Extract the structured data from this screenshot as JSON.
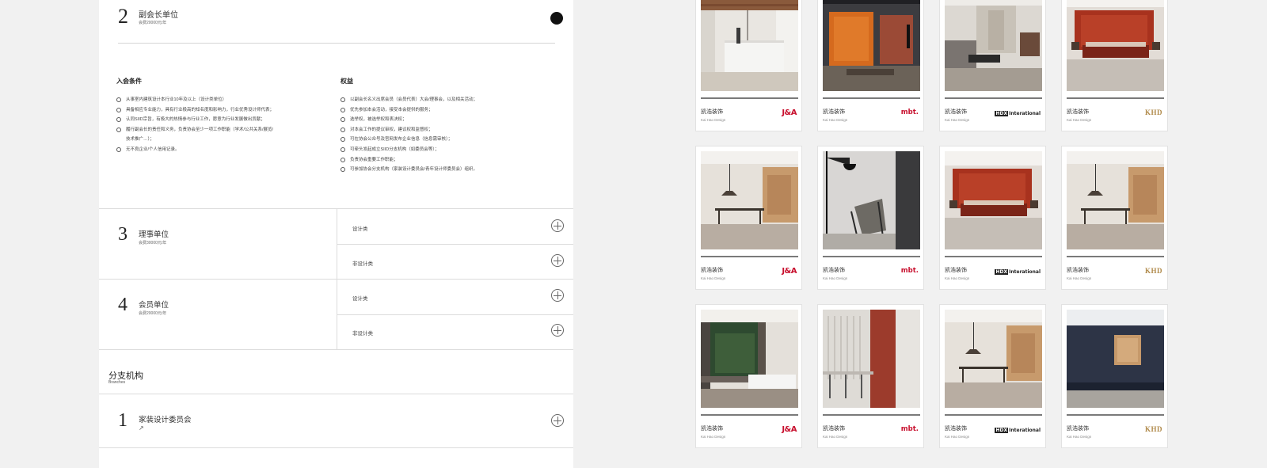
{
  "membership_2": {
    "number": "2",
    "title": "副会长单位",
    "fee": "会费20000元/年",
    "requirements_heading": "入会条件",
    "requirements": [
      "从事室内建筑设计本行业10年及以上（设计类单位）",
      "具备相应专业能力，具有行业极高的知名度和影响力，行业优秀设计师代表；",
      "认同SIID宗旨，有极大的热情参与行业工作，愿意为行业发展做出贡献；",
      "履行副会长的责任和义务，负责协会至少一项工作职能（学术/公共关系/展览/",
      "技术推广…）；",
      "无不良企业/个人信用记录。"
    ],
    "benefits_heading": "权益",
    "benefits": [
      "以副会长名义出席会员（会员代表）大会/理事会，以及相关活动；",
      "优先参加本会活动，接受本会提供的服务；",
      "选举权，被选举权和表决权；",
      "对本会工作的提议审权，建议权和监督权；",
      "可在协会公众号及官网发布企业信息（信息需审核）；",
      "可牵头发起成立SIID分支机构（如委员会等）；",
      "负责协会重要工作职能；",
      "可参加协会分支机构（家装设计委员会/青年设计师委员会）组织。"
    ]
  },
  "membership_3": {
    "number": "3",
    "title": "理事单位",
    "fee": "会费30000元/年",
    "options": [
      "设计类",
      "非设计类"
    ]
  },
  "membership_4": {
    "number": "4",
    "title": "会员单位",
    "fee": "会费20000元/年",
    "options": [
      "设计类",
      "非设计类"
    ]
  },
  "branches": {
    "title": "分支机构",
    "subtitle": "Branches",
    "items": [
      {
        "number": "1",
        "title": "家装设计委员会",
        "arrow": "↗"
      }
    ]
  },
  "cards": {
    "name_cn": "凯浩装饰",
    "name_en": "Kai Hao Design",
    "logos": {
      "ja": "J&A",
      "mbt": "mbt.",
      "hdx": "HDX",
      "hdx_tail": "Interational",
      "khd": "KHD"
    },
    "rows": [
      [
        "ja",
        "mbt",
        "hdx",
        "khd"
      ],
      [
        "ja",
        "mbt",
        "hdx",
        "khd"
      ],
      [
        "ja",
        "mbt",
        "hdx",
        "khd"
      ]
    ]
  },
  "colors": {
    "logo_red": "#c8102e",
    "logo_gold": "#b08a4a",
    "panel_bg": "#f1f1f1"
  }
}
